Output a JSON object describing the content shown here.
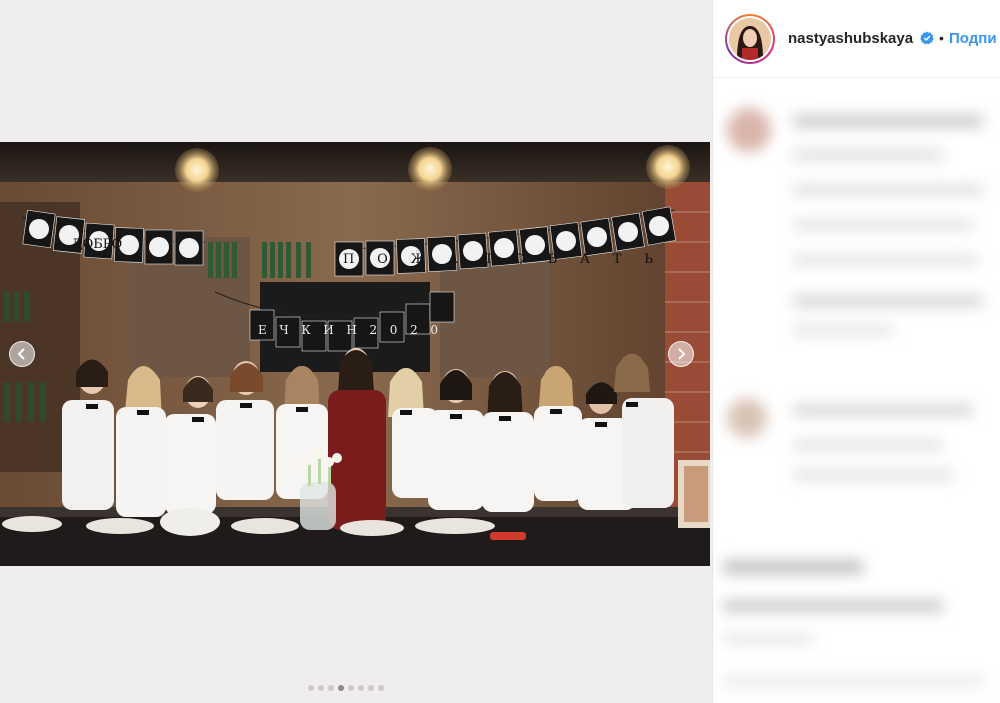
{
  "post": {
    "username": "nastyashubskaya",
    "follow_label": "Подпи",
    "separator": "•"
  },
  "banner": {
    "line1_word1": "ДОБРО",
    "line1_word2": "ПОЖАЛОВАТЬ",
    "line2": "ЕЧКИН2020"
  },
  "carousel": {
    "slide_count": 8,
    "active_index": 3
  },
  "icons": {
    "prev": "chevron-left-icon",
    "next": "chevron-right-icon",
    "verified": "verified-badge-icon"
  },
  "colors": {
    "link_blue": "#3897f0",
    "verified_blue": "#3897f0",
    "text": "#262626"
  }
}
